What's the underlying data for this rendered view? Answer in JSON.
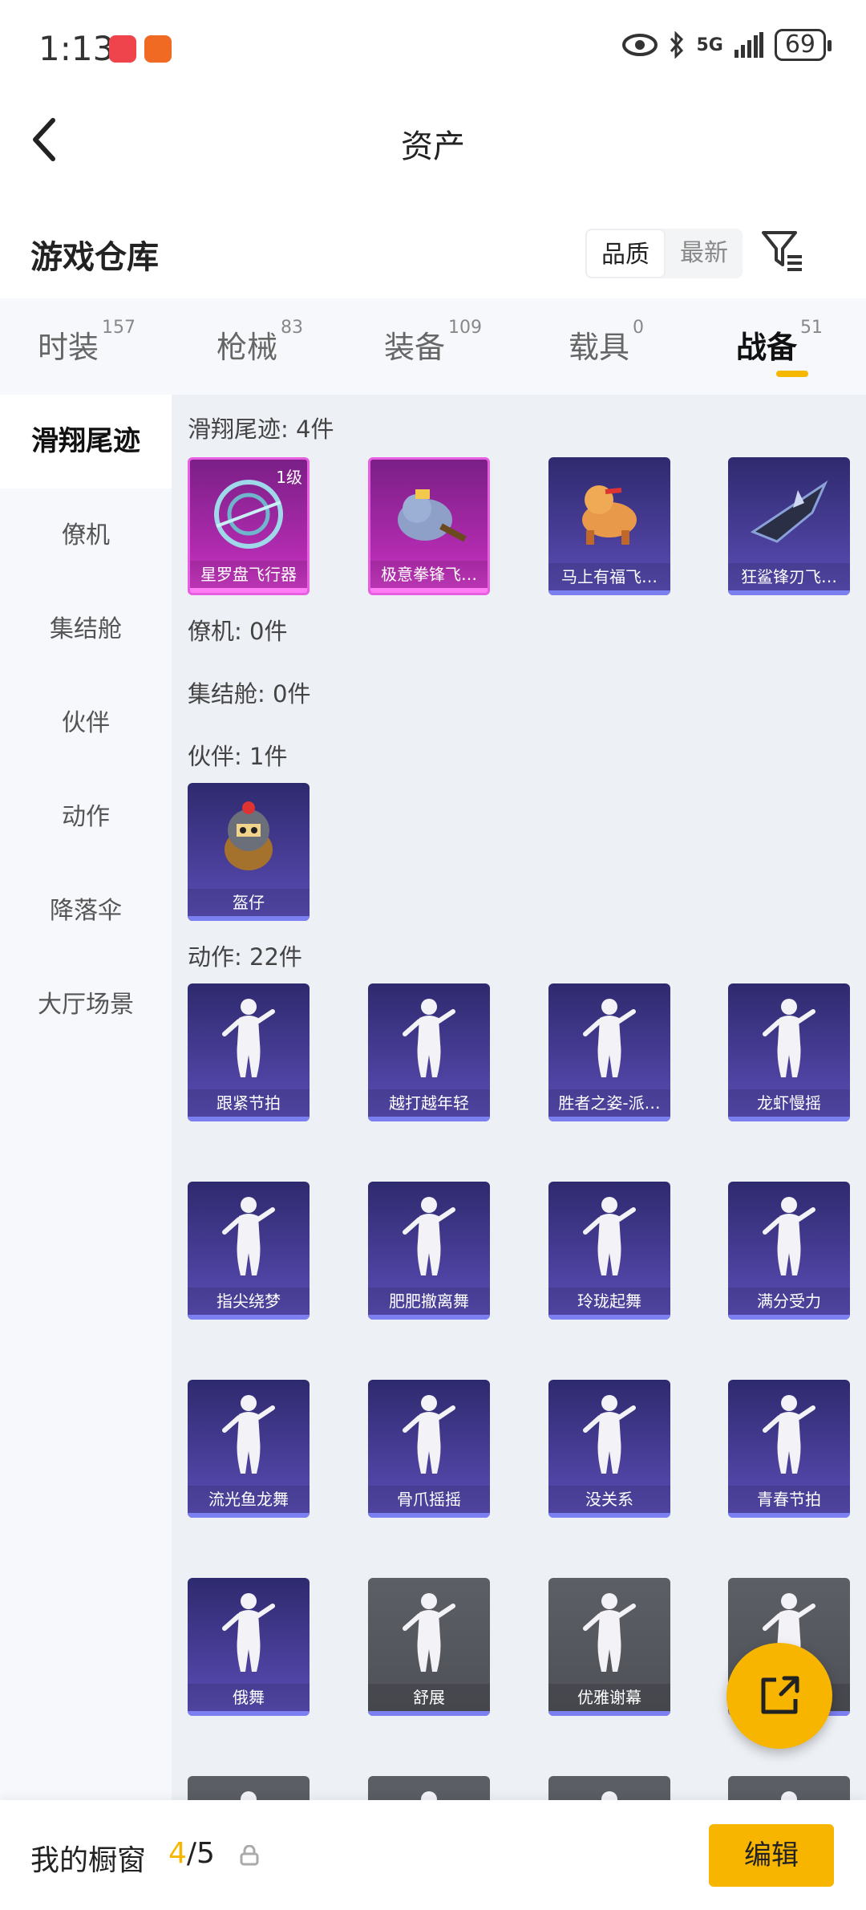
{
  "status_bar": {
    "time": "1:13",
    "network": "5G",
    "battery": "69"
  },
  "header": {
    "title": "资产"
  },
  "warehouse": {
    "title": "游戏仓库",
    "sort_options": [
      "品质",
      "最新"
    ],
    "active_sort": "品质"
  },
  "tabs": [
    {
      "label": "时装",
      "count": "157"
    },
    {
      "label": "枪械",
      "count": "83"
    },
    {
      "label": "装备",
      "count": "109"
    },
    {
      "label": "载具",
      "count": "0"
    },
    {
      "label": "战备",
      "count": "51",
      "active": true
    }
  ],
  "sidebar": [
    "滑翔尾迹",
    "僚机",
    "集结舱",
    "伙伴",
    "动作",
    "降落伞",
    "大厅场景"
  ],
  "sections": {
    "glide": {
      "title": "滑翔尾迹: 4件",
      "items": [
        {
          "label": "星罗盘飞行器",
          "level": "1级"
        },
        {
          "label": "极意拳锋飞…"
        },
        {
          "label": "马上有福飞…"
        },
        {
          "label": "狂鲨锋刃飞…"
        }
      ]
    },
    "wingman": {
      "title": "僚机: 0件"
    },
    "pod": {
      "title": "集结舱: 0件"
    },
    "partner": {
      "title": "伙伴: 1件",
      "items": [
        {
          "label": "盔仔"
        }
      ]
    },
    "emote": {
      "title": "动作: 22件",
      "items": [
        "跟紧节拍",
        "越打越年轻",
        "胜者之姿-派…",
        "龙虾慢摇",
        "指尖绕梦",
        "肥肥撤离舞",
        "玲珑起舞",
        "满分受力",
        "流光鱼龙舞",
        "骨爪摇摇",
        "没关系",
        "青春节拍",
        "俄舞",
        "舒展",
        "优雅谢幕",
        ""
      ]
    }
  },
  "bottom": {
    "label": "我的橱窗",
    "current": "4",
    "total": "/5",
    "edit": "编辑"
  },
  "colors": {
    "accent": "#f7b500",
    "card_purple": "#4a3f9a",
    "card_pink": "#b22bb0",
    "card_grey": "#5d5f66"
  }
}
